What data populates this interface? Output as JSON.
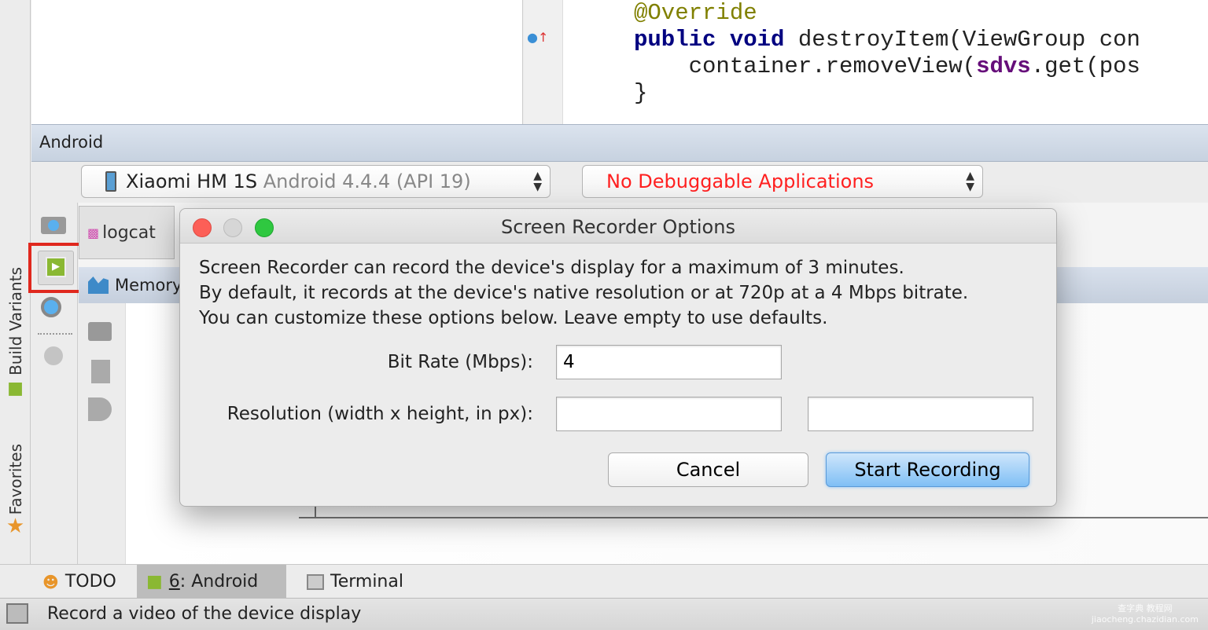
{
  "editor": {
    "lines": [
      {
        "parts": [
          {
            "t": "@Override",
            "c": "ann"
          }
        ]
      },
      {
        "parts": [
          {
            "t": "public",
            "c": "kw"
          },
          {
            "t": " "
          },
          {
            "t": "void",
            "c": "kw"
          },
          {
            "t": " destroyItem(ViewGroup con"
          }
        ]
      },
      {
        "parts": [
          {
            "t": "    container.removeView("
          },
          {
            "t": "sdvs",
            "c": "fld"
          },
          {
            "t": ".get(pos"
          }
        ]
      },
      {
        "parts": [
          {
            "t": "}"
          }
        ]
      }
    ]
  },
  "left_strip": {
    "build_variants": "Build Variants",
    "favorites": "Favorites"
  },
  "android_panel": {
    "title": "Android",
    "device": {
      "name": "Xiaomi HM 1S",
      "os": "Android 4.4.4 (API 19)"
    },
    "app_select": "No Debuggable Applications",
    "tabs": {
      "logcat": "logcat",
      "memory": "Memory"
    }
  },
  "dialog": {
    "title": "Screen Recorder Options",
    "desc": [
      "Screen Recorder can record the device's display for a maximum of 3 minutes.",
      "By default, it records at the device's native resolution or at 720p at a 4 Mbps bitrate.",
      "You can customize these options below. Leave empty to use defaults."
    ],
    "bitrate_label": "Bit Rate (Mbps):",
    "bitrate_value": "4",
    "resolution_label": "Resolution (width x height, in px):",
    "width_value": "",
    "height_value": "",
    "cancel": "Cancel",
    "start": "Start Recording"
  },
  "bottom_tabs": {
    "todo": "TODO",
    "android_num": "6",
    "android": ": Android",
    "terminal": "Terminal"
  },
  "status": "Record a video of the device display",
  "watermark": "查字典 教程网 jiaocheng.chazidian.com",
  "colors": {
    "highlight": "#e0281e",
    "android_green": "#8ab833",
    "error_text": "#ff2020",
    "primary_button": "#7fbff5"
  }
}
